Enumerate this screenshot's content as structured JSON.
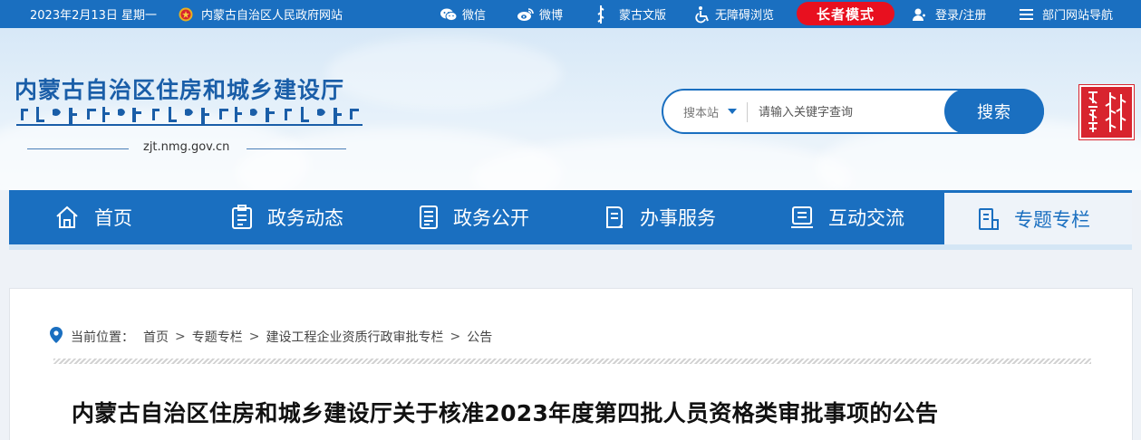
{
  "topbar": {
    "date": "2023年2月13日 星期一",
    "gov_link": "内蒙古自治区人民政府网站",
    "wechat": "微信",
    "weibo": "微博",
    "mongolian": "蒙古文版",
    "accessibility": "无障碍浏览",
    "elder_mode": "长者模式",
    "login": "登录/注册",
    "dept_nav": "部门网站导航"
  },
  "header": {
    "site_title": "内蒙古自治区住房和城乡建设厅",
    "domain": "zjt.nmg.gov.cn",
    "search": {
      "scope": "搜本站",
      "placeholder": "请输入关键字查询",
      "button": "搜索"
    }
  },
  "nav": {
    "items": [
      {
        "label": "首页",
        "icon": "home-icon"
      },
      {
        "label": "政务动态",
        "icon": "clipboard-icon"
      },
      {
        "label": "政务公开",
        "icon": "document-icon"
      },
      {
        "label": "办事服务",
        "icon": "service-icon"
      },
      {
        "label": "互动交流",
        "icon": "chat-book-icon"
      },
      {
        "label": "专题专栏",
        "icon": "special-icon"
      }
    ],
    "active_index": 5
  },
  "breadcrumb": {
    "prefix": "当前位置：",
    "items": [
      "首页",
      "专题专栏",
      "建设工程企业资质行政审批专栏",
      "公告"
    ],
    "separator": ">"
  },
  "article": {
    "title": "内蒙古自治区住房和城乡建设厅关于核准2023年度第四批人员资格类审批事项的公告"
  },
  "colors": {
    "primary": "#1a6fc0",
    "elder_mode_bg": "#e8101f",
    "mongol_badge": "#d8242e"
  }
}
